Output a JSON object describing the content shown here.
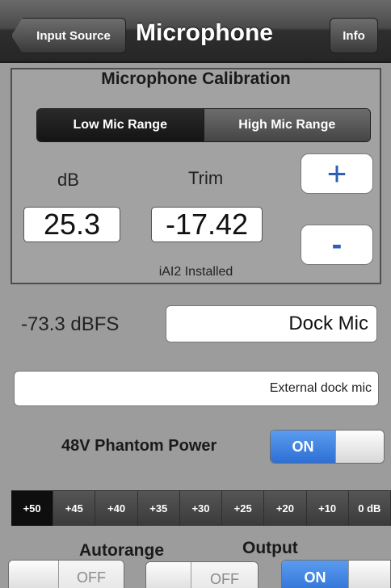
{
  "navbar": {
    "back_label": "Input Source",
    "title": "Microphone",
    "info_label": "Info"
  },
  "calibration": {
    "title": "Microphone Calibration",
    "range_segments": [
      {
        "label": "Low Mic Range",
        "selected": true
      },
      {
        "label": "High Mic Range",
        "selected": false
      }
    ],
    "db_label": "dB",
    "trim_label": "Trim",
    "db_value": "25.3",
    "trim_value": "-17.42",
    "plus_label": "+",
    "minus_label": "-",
    "status": "iAI2 Installed"
  },
  "level": {
    "dbfs": "-73.3 dBFS",
    "mic_name": "Dock Mic",
    "description": "External dock mic"
  },
  "phantom": {
    "label": "48V Phantom Power",
    "state": "ON"
  },
  "range_selector": {
    "items": [
      "+50",
      "+45",
      "+40",
      "+35",
      "+30",
      "+25",
      "+20",
      "+10",
      "0 dB"
    ],
    "selected_index": 0
  },
  "autorange": {
    "label": "Autorange",
    "state": "OFF"
  },
  "output": {
    "label": "Output",
    "off_label": "OFF",
    "on_label": "ON"
  },
  "colors": {
    "background": "#9c9c9c",
    "switch_on": "#2d6fd4",
    "stepper_text": "#2f5fb5"
  }
}
